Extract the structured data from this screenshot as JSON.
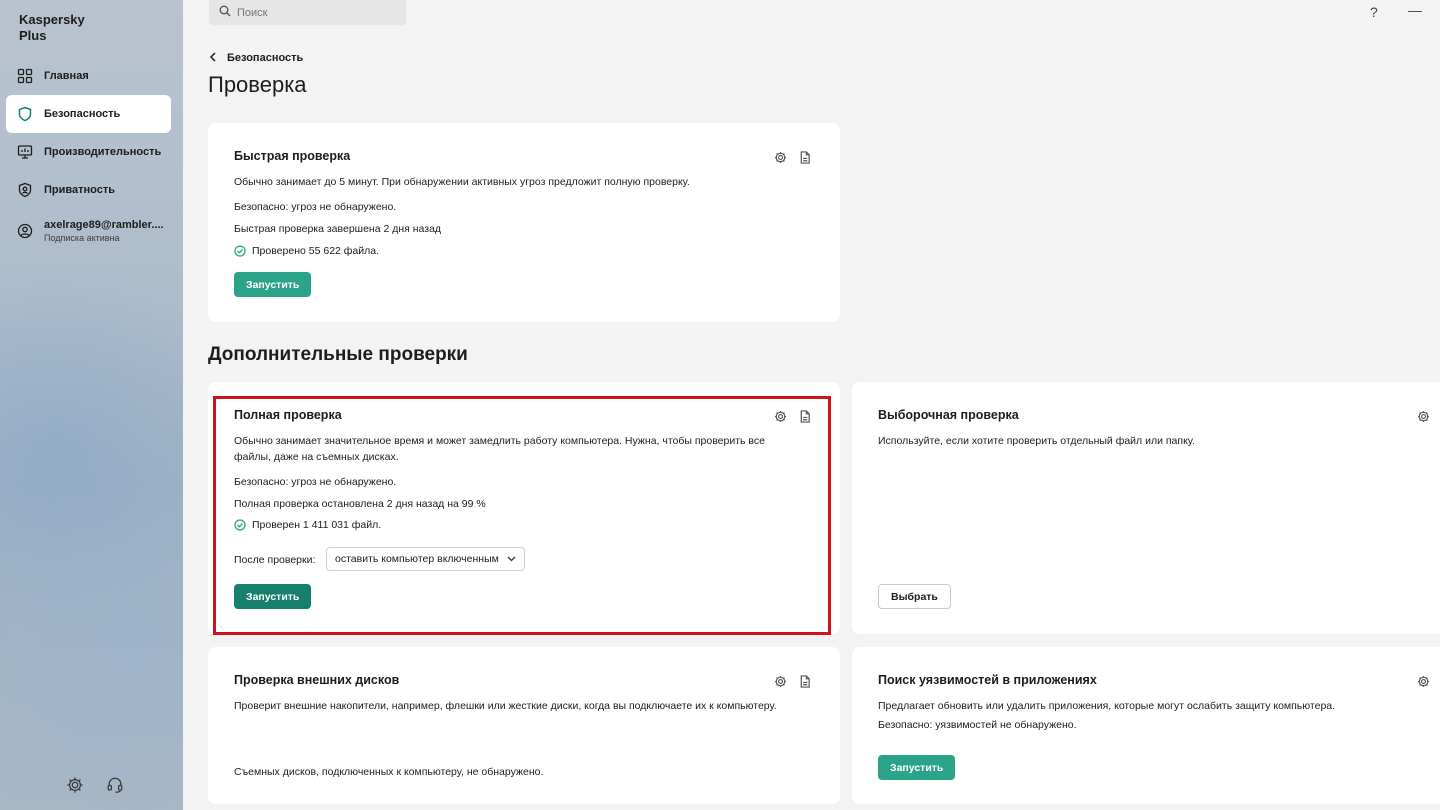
{
  "app": {
    "title_line1": "Kaspersky",
    "title_line2": "Plus"
  },
  "sidebar": {
    "items": [
      {
        "label": "Главная",
        "icon": "grid-icon"
      },
      {
        "label": "Безопасность",
        "icon": "shield-icon",
        "active": true
      },
      {
        "label": "Производительность",
        "icon": "monitor-icon"
      },
      {
        "label": "Приватность",
        "icon": "privacy-shield-icon"
      }
    ],
    "account": {
      "email": "axelrage89@rambler....",
      "status": "Подписка активна"
    }
  },
  "search": {
    "placeholder": "Поиск"
  },
  "topbar": {
    "help": "?",
    "minimize": "—"
  },
  "breadcrumb": {
    "label": "Безопасность"
  },
  "page": {
    "title": "Проверка",
    "section_title": "Дополнительные проверки"
  },
  "quick_scan": {
    "title": "Быстрая проверка",
    "description": "Обычно занимает до 5 минут. При обнаружении активных угроз предложит полную проверку.",
    "status": "Безопасно: угроз не обнаружено.",
    "last": "Быстрая проверка завершена 2 дня назад",
    "checked": "Проверено 55 622 файла.",
    "button": "Запустить"
  },
  "full_scan": {
    "title": "Полная проверка",
    "description_line1": "Обычно занимает значительное время и может замедлить работу компьютера. Нужна, чтобы проверить все",
    "description_line2": "файлы, даже на съемных дисках.",
    "status": "Безопасно: угроз не обнаружено.",
    "last": "Полная проверка остановлена 2 дня назад на 99 %",
    "checked": "Проверен 1 411 031 файл.",
    "after_label": "После проверки:",
    "after_value": "оставить компьютер включенным",
    "button": "Запустить"
  },
  "custom_scan": {
    "title": "Выборочная проверка",
    "description": "Используйте, если хотите проверить отдельный файл или папку.",
    "button": "Выбрать"
  },
  "external_scan": {
    "title": "Проверка внешних дисков",
    "description": "Проверит внешние накопители, например, флешки или жесткие диски, когда вы подключаете их к компьютеру.",
    "status": "Съемных дисков, подключенных к компьютеру, не обнаружено."
  },
  "vuln_scan": {
    "title": "Поиск уязвимостей в приложениях",
    "description": "Предлагает обновить или удалить приложения, которые могут ослабить защиту компьютера.",
    "status": "Безопасно: уязвимостей не обнаружено.",
    "button": "Запустить"
  },
  "colors": {
    "accent": "#2aa389",
    "accent_dark": "#16806c",
    "highlight": "#d0121b"
  }
}
